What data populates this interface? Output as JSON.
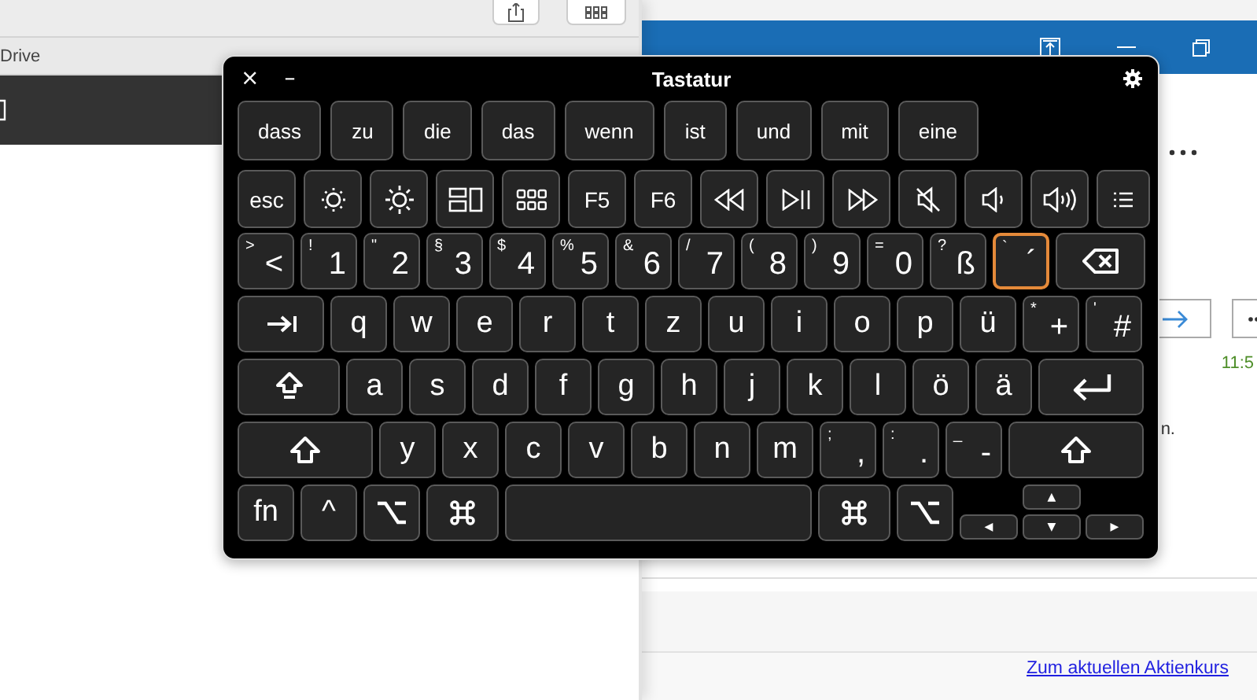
{
  "left_window": {
    "column_header": "Drive"
  },
  "right_window": {
    "time": "11:5",
    "fragment": "n.",
    "stock_link": "Zum aktuellen Aktienkurs"
  },
  "keyboard": {
    "title": "Tastatur",
    "close": "×",
    "minimize": "–",
    "suggestions": [
      "dass",
      "zu",
      "die",
      "das",
      "wenn",
      "ist",
      "und",
      "mit",
      "eine"
    ],
    "function_row": [
      {
        "kind": "label",
        "label": "esc"
      },
      {
        "kind": "brightness-low"
      },
      {
        "kind": "brightness-high"
      },
      {
        "kind": "windows"
      },
      {
        "kind": "grid"
      },
      {
        "kind": "label",
        "label": "F5"
      },
      {
        "kind": "label",
        "label": "F6"
      },
      {
        "kind": "rewind"
      },
      {
        "kind": "play-pause"
      },
      {
        "kind": "fast-forward"
      },
      {
        "kind": "mute"
      },
      {
        "kind": "volume-down"
      },
      {
        "kind": "volume-up"
      },
      {
        "kind": "list"
      }
    ],
    "number_row": [
      {
        "kind": "dual",
        "shift": ">",
        "label": "<",
        "selected": false
      },
      {
        "kind": "dual",
        "shift": "!",
        "label": "1",
        "selected": false
      },
      {
        "kind": "dual",
        "shift": "\"",
        "label": "2",
        "selected": false
      },
      {
        "kind": "dual",
        "shift": "§",
        "label": "3",
        "selected": false
      },
      {
        "kind": "dual",
        "shift": "$",
        "label": "4",
        "selected": false
      },
      {
        "kind": "dual",
        "shift": "%",
        "label": "5",
        "selected": false
      },
      {
        "kind": "dual",
        "shift": "&",
        "label": "6",
        "selected": false
      },
      {
        "kind": "dual",
        "shift": "/",
        "label": "7",
        "selected": false
      },
      {
        "kind": "dual",
        "shift": "(",
        "label": "8",
        "selected": false
      },
      {
        "kind": "dual",
        "shift": ")",
        "label": "9",
        "selected": false
      },
      {
        "kind": "dual",
        "shift": "=",
        "label": "0",
        "selected": false
      },
      {
        "kind": "dual",
        "shift": "?",
        "label": "ß",
        "selected": false
      },
      {
        "kind": "dual",
        "shift": "`",
        "label": "´",
        "selected": true
      },
      {
        "kind": "backspace",
        "selected": false
      }
    ],
    "letter_rows": [
      [
        {
          "kind": "tab"
        },
        {
          "kind": "char",
          "label": "q"
        },
        {
          "kind": "char",
          "label": "w"
        },
        {
          "kind": "char",
          "label": "e"
        },
        {
          "kind": "char",
          "label": "r"
        },
        {
          "kind": "char",
          "label": "t"
        },
        {
          "kind": "char",
          "label": "z"
        },
        {
          "kind": "char",
          "label": "u"
        },
        {
          "kind": "char",
          "label": "i"
        },
        {
          "kind": "char",
          "label": "o"
        },
        {
          "kind": "char",
          "label": "p"
        },
        {
          "kind": "char",
          "label": "ü"
        },
        {
          "kind": "dual",
          "shift": "*",
          "label": "+"
        },
        {
          "kind": "dual",
          "shift": "'",
          "label": "#"
        }
      ],
      [
        {
          "kind": "caps-lock"
        },
        {
          "kind": "char",
          "label": "a"
        },
        {
          "kind": "char",
          "label": "s"
        },
        {
          "kind": "char",
          "label": "d"
        },
        {
          "kind": "char",
          "label": "f"
        },
        {
          "kind": "char",
          "label": "g"
        },
        {
          "kind": "char",
          "label": "h"
        },
        {
          "kind": "char",
          "label": "j"
        },
        {
          "kind": "char",
          "label": "k"
        },
        {
          "kind": "char",
          "label": "l"
        },
        {
          "kind": "char",
          "label": "ö"
        },
        {
          "kind": "char",
          "label": "ä"
        },
        {
          "kind": "return"
        }
      ],
      [
        {
          "kind": "shift"
        },
        {
          "kind": "char",
          "label": "y"
        },
        {
          "kind": "char",
          "label": "x"
        },
        {
          "kind": "char",
          "label": "c"
        },
        {
          "kind": "char",
          "label": "v"
        },
        {
          "kind": "char",
          "label": "b"
        },
        {
          "kind": "char",
          "label": "n"
        },
        {
          "kind": "char",
          "label": "m"
        },
        {
          "kind": "dual",
          "shift": ";",
          "label": ","
        },
        {
          "kind": "dual",
          "shift": ":",
          "label": "."
        },
        {
          "kind": "dual",
          "shift": "_",
          "label": "-"
        },
        {
          "kind": "shift"
        }
      ],
      [
        {
          "kind": "label",
          "label": "fn"
        },
        {
          "kind": "char",
          "label": "^"
        },
        {
          "kind": "option"
        },
        {
          "kind": "command"
        },
        {
          "kind": "space"
        },
        {
          "kind": "command"
        },
        {
          "kind": "option"
        },
        {
          "kind": "arrows",
          "up": "▲",
          "left": "◀",
          "down": "▼",
          "right": "▶"
        }
      ]
    ]
  }
}
